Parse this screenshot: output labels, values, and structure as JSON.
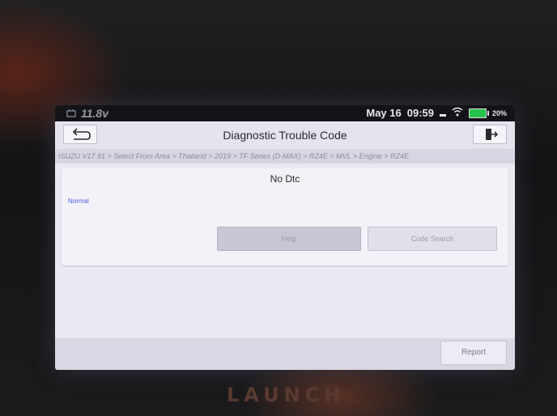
{
  "status_bar": {
    "battery_voltage": "11.8v",
    "date": "May 16",
    "time": "09:59",
    "battery_percent": "20%"
  },
  "header": {
    "title": "Diagnostic Trouble Code"
  },
  "breadcrumb": "ISUZU V17.91 > Select From Area > Thailand > 2019 > TF Series (D-MAX) > RZ4E > MVL > Engine > RZ4E",
  "result": {
    "heading": "No Dtc",
    "status": "Normal"
  },
  "buttons": {
    "help": "Help",
    "code_search": "Code Search",
    "report": "Report"
  },
  "device_brand": "LAUNCH",
  "colors": {
    "status_normal": "#4a62d4",
    "battery_icon": "#27c24c"
  }
}
